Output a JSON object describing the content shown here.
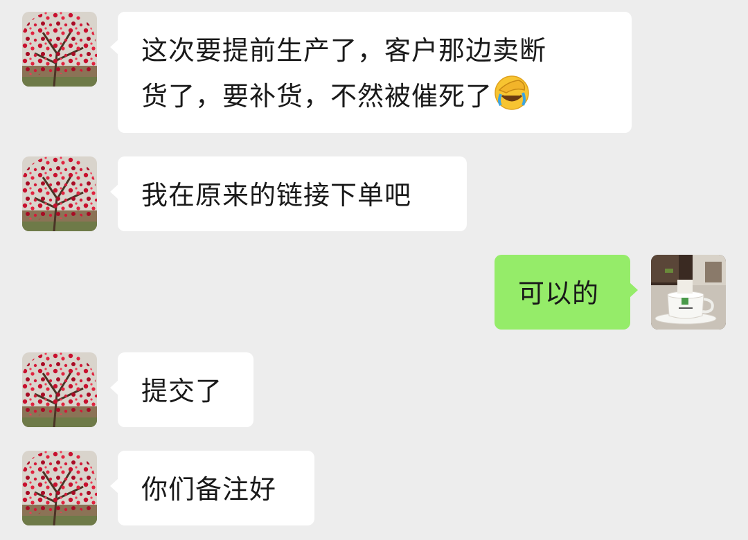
{
  "colors": {
    "background": "#ededed",
    "incoming_bubble": "#ffffff",
    "outgoing_bubble": "#95ec69",
    "text": "#191919"
  },
  "messages": [
    {
      "sender": "contact",
      "avatar": "red-blossom-tree-avatar",
      "text_line1": "这次要提前生产了，客户那边卖断",
      "text_line2": "货了，要补货，不然被催死了",
      "emoji": "face-palm-crying-emoji"
    },
    {
      "sender": "contact",
      "avatar": "red-blossom-tree-avatar",
      "text": "我在原来的链接下单吧"
    },
    {
      "sender": "me",
      "avatar": "coffee-cup-avatar",
      "text": "可以的"
    },
    {
      "sender": "contact",
      "avatar": "red-blossom-tree-avatar",
      "text": "提交了"
    },
    {
      "sender": "contact",
      "avatar": "red-blossom-tree-avatar",
      "text": "你们备注好"
    }
  ]
}
